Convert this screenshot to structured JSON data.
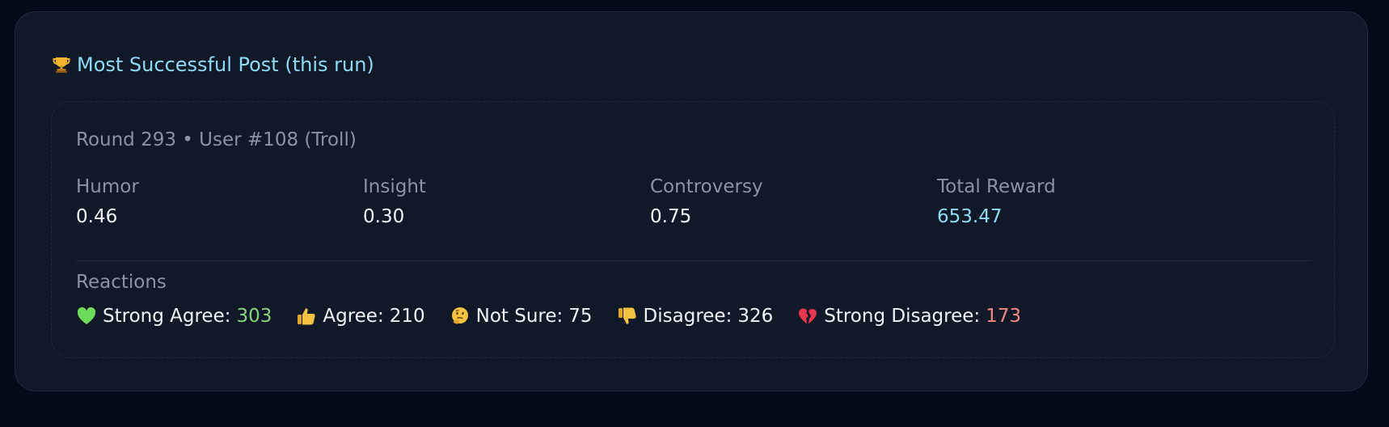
{
  "card": {
    "title": "Most Successful Post (this run)",
    "title_icon": "trophy-icon"
  },
  "post": {
    "meta": "Round 293 • User #108 (Troll)",
    "metrics": [
      {
        "label": "Humor",
        "value": "0.46"
      },
      {
        "label": "Insight",
        "value": "0.30"
      },
      {
        "label": "Controversy",
        "value": "0.75"
      },
      {
        "label": "Total Reward",
        "value": "653.47"
      }
    ],
    "reactions_label": "Reactions",
    "reactions": [
      {
        "icon": "green-heart-icon",
        "label": "Strong Agree:",
        "count": "303",
        "count_color": "#86d47d"
      },
      {
        "icon": "thumbs-up-icon",
        "label": "Agree:",
        "count": "210"
      },
      {
        "icon": "thinking-face-icon",
        "label": "Not Sure:",
        "count": "75"
      },
      {
        "icon": "thumbs-down-icon",
        "label": "Disagree:",
        "count": "326"
      },
      {
        "icon": "broken-heart-icon",
        "label": "Strong Disagree:",
        "count": "173",
        "count_color": "#f08a82"
      }
    ]
  },
  "colors": {
    "page_background": "#050a18",
    "card_background": "#111828",
    "accent": "#8cdcf5",
    "muted_text": "#8b93a4",
    "primary_text": "#f1f4f8"
  }
}
